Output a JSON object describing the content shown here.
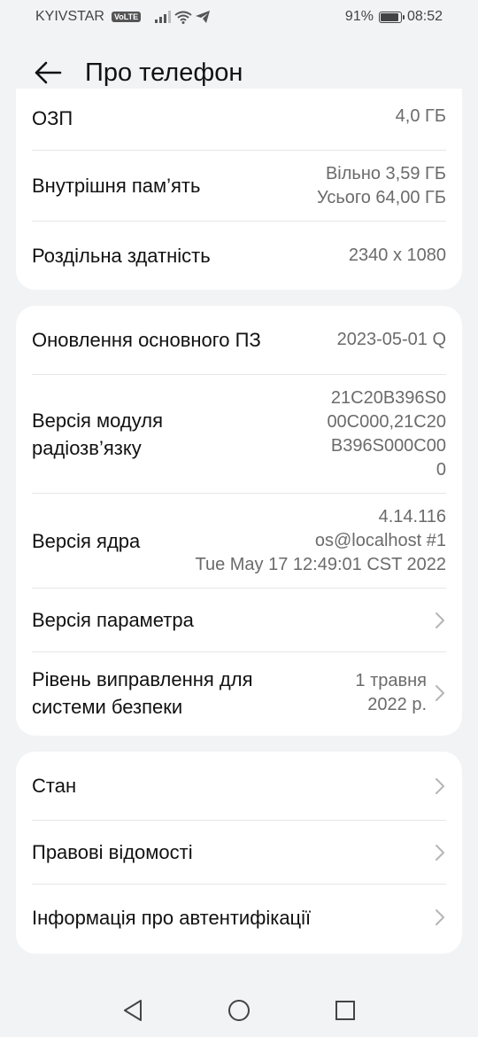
{
  "status_bar": {
    "carrier": "KYIVSTAR",
    "volte": "VoLTE",
    "battery_pct": "91%",
    "battery_level": 0.91,
    "time": "08:52"
  },
  "header": {
    "title": "Про телефон",
    "back_icon": "arrow-left-icon"
  },
  "group1": {
    "ram_label": "ОЗП",
    "ram_value": "4,0 ГБ",
    "storage_label": "Внутрішня пам’ять",
    "storage_free": "Вільно 3,59  ГБ",
    "storage_total": "Усього 64,00  ГБ",
    "resolution_label": "Роздільна здатність",
    "resolution_value": "2340 x 1080"
  },
  "group2": {
    "firmware_label": "Оновлення основного ПЗ",
    "firmware_value": "2023-05-01 Q",
    "baseband_label_1": "Версія модуля",
    "baseband_label_2": "радіозв’язку",
    "baseband_value_1": "21C20B396S0",
    "baseband_value_2": "00C000,21C20",
    "baseband_value_3": "B396S000C00",
    "baseband_value_4": "0",
    "kernel_label": "Версія ядра",
    "kernel_value_1": "4.14.116",
    "kernel_value_2": "os@localhost #1",
    "kernel_value_3": "Tue May 17 12:49:01 CST 2022",
    "param_label": "Версія параметра",
    "patch_label_1": "Рівень виправлення для",
    "patch_label_2": "системи безпеки",
    "patch_value_1": "1 травня",
    "patch_value_2": "2022 р."
  },
  "group3": {
    "status_label": "Стан",
    "legal_label": "Правові відомості",
    "auth_label": "Інформація про автентифікації"
  },
  "nav": {
    "back": "triangle-back-icon",
    "home": "circle-home-icon",
    "recents": "square-recents-icon"
  }
}
